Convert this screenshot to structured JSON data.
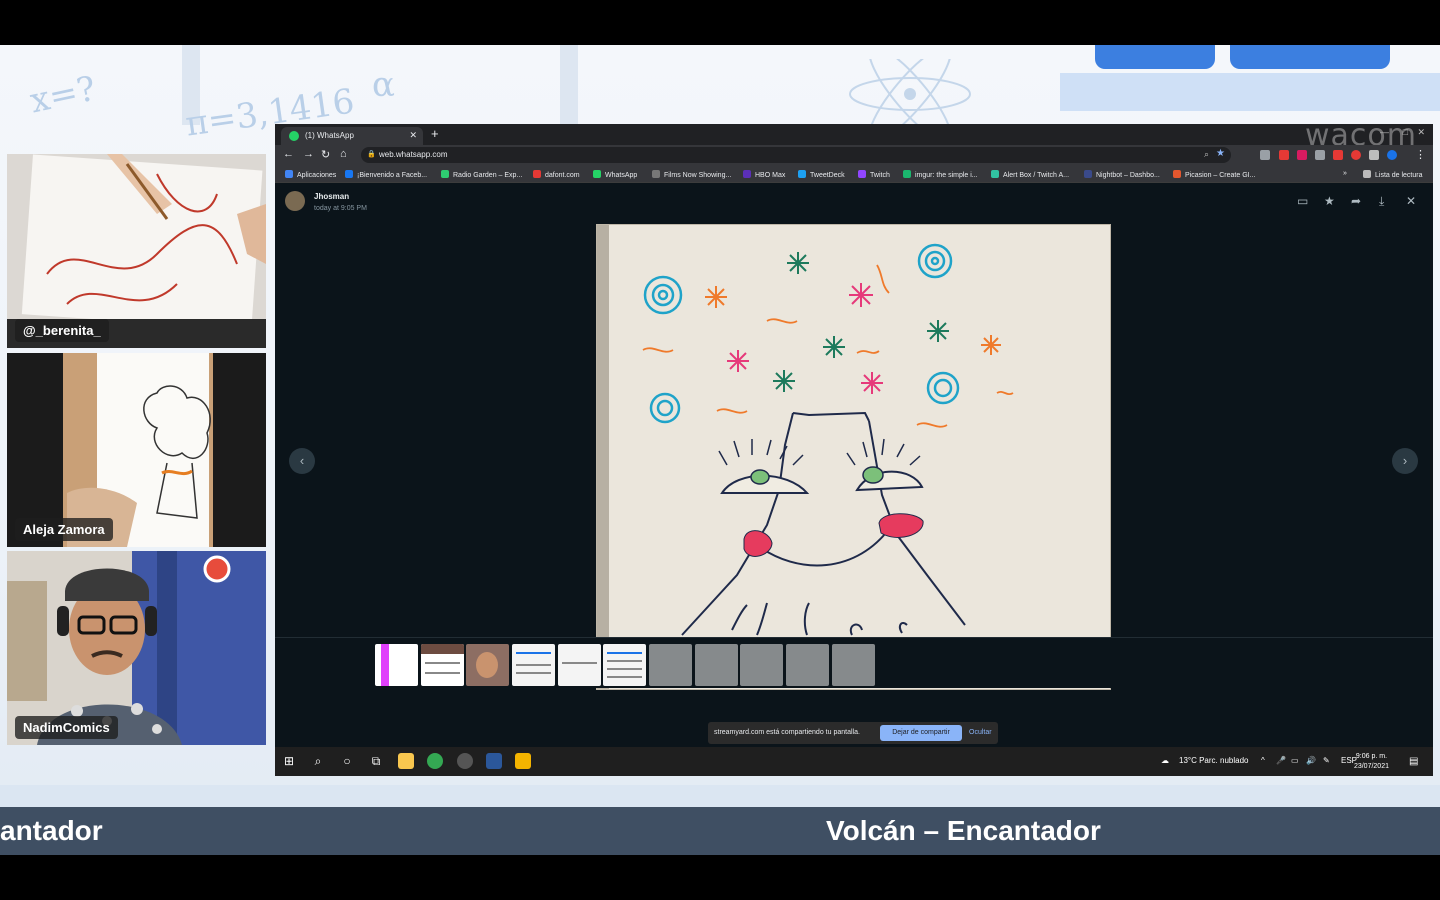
{
  "overlay": {
    "formulas": [
      "x=?",
      "π=3,1416",
      "α"
    ],
    "lower_third_left": "antador",
    "lower_third_right": "Volcán – Encantador"
  },
  "participants": [
    {
      "name": "@_berenita_"
    },
    {
      "name": "Aleja Zamora"
    },
    {
      "name": "NadimComics"
    }
  ],
  "browser": {
    "tab_title": "(1) WhatsApp",
    "url": "web.whatsapp.com",
    "watermark": "wacom",
    "bookmarks": [
      {
        "label": "Aplicaciones",
        "color": "#4285f4"
      },
      {
        "label": "¡Bienvenido a Faceb...",
        "color": "#1877f2"
      },
      {
        "label": "Radio Garden – Exp...",
        "color": "#2ecc71"
      },
      {
        "label": "dafont.com",
        "color": "#e53935"
      },
      {
        "label": "WhatsApp",
        "color": "#25d366"
      },
      {
        "label": "Films Now Showing...",
        "color": "#777777"
      },
      {
        "label": "HBO Max",
        "color": "#5b2fb8"
      },
      {
        "label": "TweetDeck",
        "color": "#1da1f2"
      },
      {
        "label": "Twitch",
        "color": "#9146ff"
      },
      {
        "label": "imgur: the simple i...",
        "color": "#1bb76e"
      },
      {
        "label": "Alert Box / Twitch A...",
        "color": "#31c3a2"
      },
      {
        "label": "Nightbot – Dashbo...",
        "color": "#3a4a8a"
      },
      {
        "label": "Picasion – Create GI...",
        "color": "#e4572e"
      }
    ],
    "reading_list": "Lista de lectura"
  },
  "whatsapp_viewer": {
    "sender": "Jhosman",
    "timestamp": "today at 9:05 PM",
    "icons": [
      "message-icon",
      "star-icon",
      "forward-icon",
      "download-icon",
      "close-icon"
    ]
  },
  "screen_share": {
    "message": "streamyard.com está compartiendo tu pantalla.",
    "stop_label": "Dejar de compartir",
    "hide_label": "Ocultar"
  },
  "taskbar": {
    "weather": "13°C  Parc. nublado",
    "lang": "ESP",
    "time": "9:06 p. m.",
    "date": "23/07/2021"
  },
  "colors": {
    "whatsapp_bg": "#0b141a",
    "browser_dark": "#35363a",
    "share_button": "#8ab4f8",
    "lower_third": "#3f4f63"
  }
}
